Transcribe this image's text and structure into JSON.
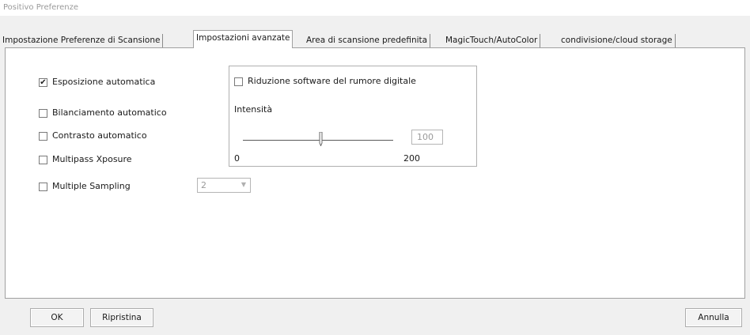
{
  "window": {
    "title": "Positivo Preferenze"
  },
  "tabs": [
    {
      "label": "Impostazione Preferenze di Scansione",
      "active": false
    },
    {
      "label": "Impostazioni avanzate",
      "active": true
    },
    {
      "label": "Area di scansione predefinita",
      "active": false
    },
    {
      "label": "MagicTouch/AutoColor",
      "active": false
    },
    {
      "label": "condivisione/cloud storage",
      "active": false
    }
  ],
  "options": {
    "auto_exposure": {
      "label": "Esposizione automatica",
      "checked": true
    },
    "auto_white_balance": {
      "label": "Bilanciamento automatico",
      "checked": false
    },
    "auto_contrast": {
      "label": "Contrasto automatico",
      "checked": false
    },
    "multipass_xposure": {
      "label": "Multipass Xposure",
      "checked": false
    },
    "multiple_sampling": {
      "label": "Multiple Sampling",
      "checked": false,
      "value": "2"
    }
  },
  "noise_reduction": {
    "label": "Riduzione software del rumore digitale",
    "checked": false,
    "intensity_label": "Intensità",
    "value": "100",
    "min_label": "0",
    "max_label": "200",
    "slider_level": 0.52
  },
  "buttons": {
    "ok": "OK",
    "reset": "Ripristina",
    "cancel": "Annulla"
  },
  "icons": {
    "checkmark": "✔",
    "dropdown": "▼"
  }
}
